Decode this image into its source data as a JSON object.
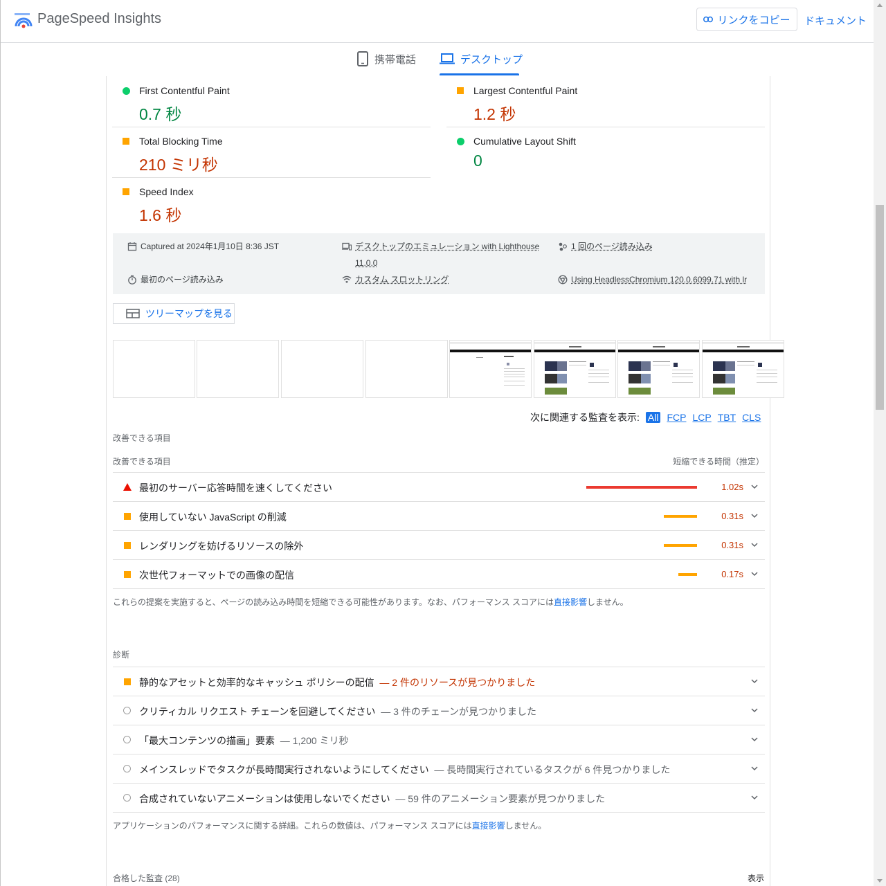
{
  "header": {
    "title": "PageSpeed Insights",
    "copy_link": "リンクをコピー",
    "docs": "ドキュメント"
  },
  "tabs": {
    "mobile": "携帯電話",
    "desktop": "デスクトップ",
    "active": "desktop"
  },
  "metrics": [
    {
      "label": "First Contentful Paint",
      "value": "0.7 秒",
      "status": "pass"
    },
    {
      "label": "Largest Contentful Paint",
      "value": "1.2 秒",
      "status": "average"
    },
    {
      "label": "Total Blocking Time",
      "value": "210 ミリ秒",
      "status": "average"
    },
    {
      "label": "Cumulative Layout Shift",
      "value": "0",
      "status": "pass"
    },
    {
      "label": "Speed Index",
      "value": "1.6 秒",
      "status": "average"
    }
  ],
  "runtime_info": {
    "captured": "Captured at 2024年1月10日 8:36 JST",
    "emulation_line1": "デスクトップのエミュレーション with Lighthouse",
    "emulation_line2": "11.0.0",
    "loads": "1 回のページ読み込み",
    "initial_load": "最初のページ読み込み",
    "throttling": "カスタム スロットリング",
    "browser": "Using HeadlessChromium 120.0.6099.71 with lr"
  },
  "treemap_button": "ツリーマップを見る",
  "filter": {
    "label": "次に関連する監査を表示:",
    "options": [
      "All",
      "FCP",
      "LCP",
      "TBT",
      "CLS"
    ],
    "active": "All"
  },
  "opportunities": {
    "section_title": "改善できる項目",
    "col_left": "改善できる項目",
    "col_right": "短縮できる時間（推定）",
    "items": [
      {
        "label": "最初のサーバー応答時間を速くしてください",
        "value": "1.02s",
        "severity": "fail",
        "savings_fraction": 1.0
      },
      {
        "label": "使用していない JavaScript の削減",
        "value": "0.31s",
        "severity": "average",
        "savings_fraction": 0.3
      },
      {
        "label": "レンダリングを妨げるリソースの除外",
        "value": "0.31s",
        "severity": "average",
        "savings_fraction": 0.3
      },
      {
        "label": "次世代フォーマットでの画像の配信",
        "value": "0.17s",
        "severity": "average",
        "savings_fraction": 0.17
      }
    ],
    "note_prefix": "これらの提案を実施すると、ページの読み込み時間を短縮できる可能性があります。なお、パフォーマンス スコアには",
    "note_link": "直接影響",
    "note_suffix": "しません。"
  },
  "diagnostics": {
    "section_title": "診断",
    "items": [
      {
        "label": "静的なアセットと効率的なキャッシュ ポリシーの配信",
        "detail": "— 2 件のリソースが見つかりました",
        "severity": "average"
      },
      {
        "label": "クリティカル リクエスト チェーンを回避してください",
        "detail": "— 3 件のチェーンが見つかりました",
        "severity": "info"
      },
      {
        "label": "「最大コンテンツの描画」要素",
        "detail": "— 1,200 ミリ秒",
        "severity": "info"
      },
      {
        "label": "メインスレッドでタスクが長時間実行されないようにしてください",
        "detail": "— 長時間実行されているタスクが 6 件見つかりました",
        "severity": "info"
      },
      {
        "label": "合成されていないアニメーションは使用しないでください",
        "detail": "— 59 件のアニメーション要素が見つかりました",
        "severity": "info"
      }
    ],
    "note_prefix": "アプリケーションのパフォーマンスに関する詳細。これらの数値は、パフォーマンス スコアには",
    "note_link": "直接影響",
    "note_suffix": "しません。"
  },
  "passed": {
    "label": "合格した監査",
    "count": "(28)",
    "show": "表示"
  },
  "colors": {
    "accent": "#1a73e8",
    "pass": "#0cce6b",
    "average": "#ffa400",
    "fail": "#eb0f00"
  }
}
